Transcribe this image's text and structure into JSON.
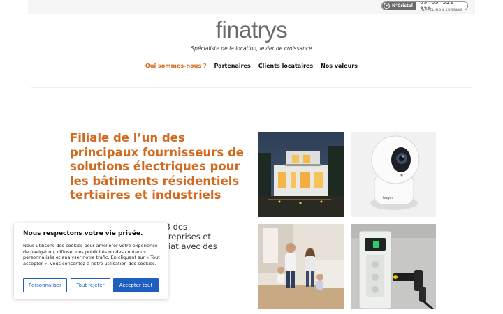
{
  "topbar": {
    "cristal_label": "N°Cristal",
    "phone": "09 69 322 320",
    "subnote": "APPEL NON SURTAXÉ"
  },
  "header": {
    "logo": "finatrys",
    "tagline": "Spécialiste de la location, levier de croissance"
  },
  "nav": {
    "items": [
      {
        "label": "Qui sommes-nous ?",
        "active": true
      },
      {
        "label": "Partenaires"
      },
      {
        "label": "Clients locataires"
      },
      {
        "label": "Nos valeurs"
      }
    ]
  },
  "main": {
    "headline": "Filiale de l’un des principaux fournisseurs de solutions électriques pour les bâtiments résidentiels tertiaires et industriels",
    "body_lines": [
      "013 des",
      "entreprises et",
      "nariat avec des"
    ]
  },
  "images": {
    "tile_2_brand": "hager"
  },
  "cookie": {
    "title": "Nous respectons votre vie privée.",
    "text": "Nous utilisons des cookies pour améliorer votre expérience de navigation, diffuser des publicités ou des contenus personnalisés et analyser notre trafic. En cliquant sur « Tout accepter », vous consentez à notre utilisation des cookies.",
    "customize_label": "Personnaliser",
    "reject_label": "Tout rejeter",
    "accept_label": "Accepter tout"
  },
  "colors": {
    "accent": "#d2691e",
    "button": "#1f5fbf",
    "logo": "#6b6b6b"
  }
}
